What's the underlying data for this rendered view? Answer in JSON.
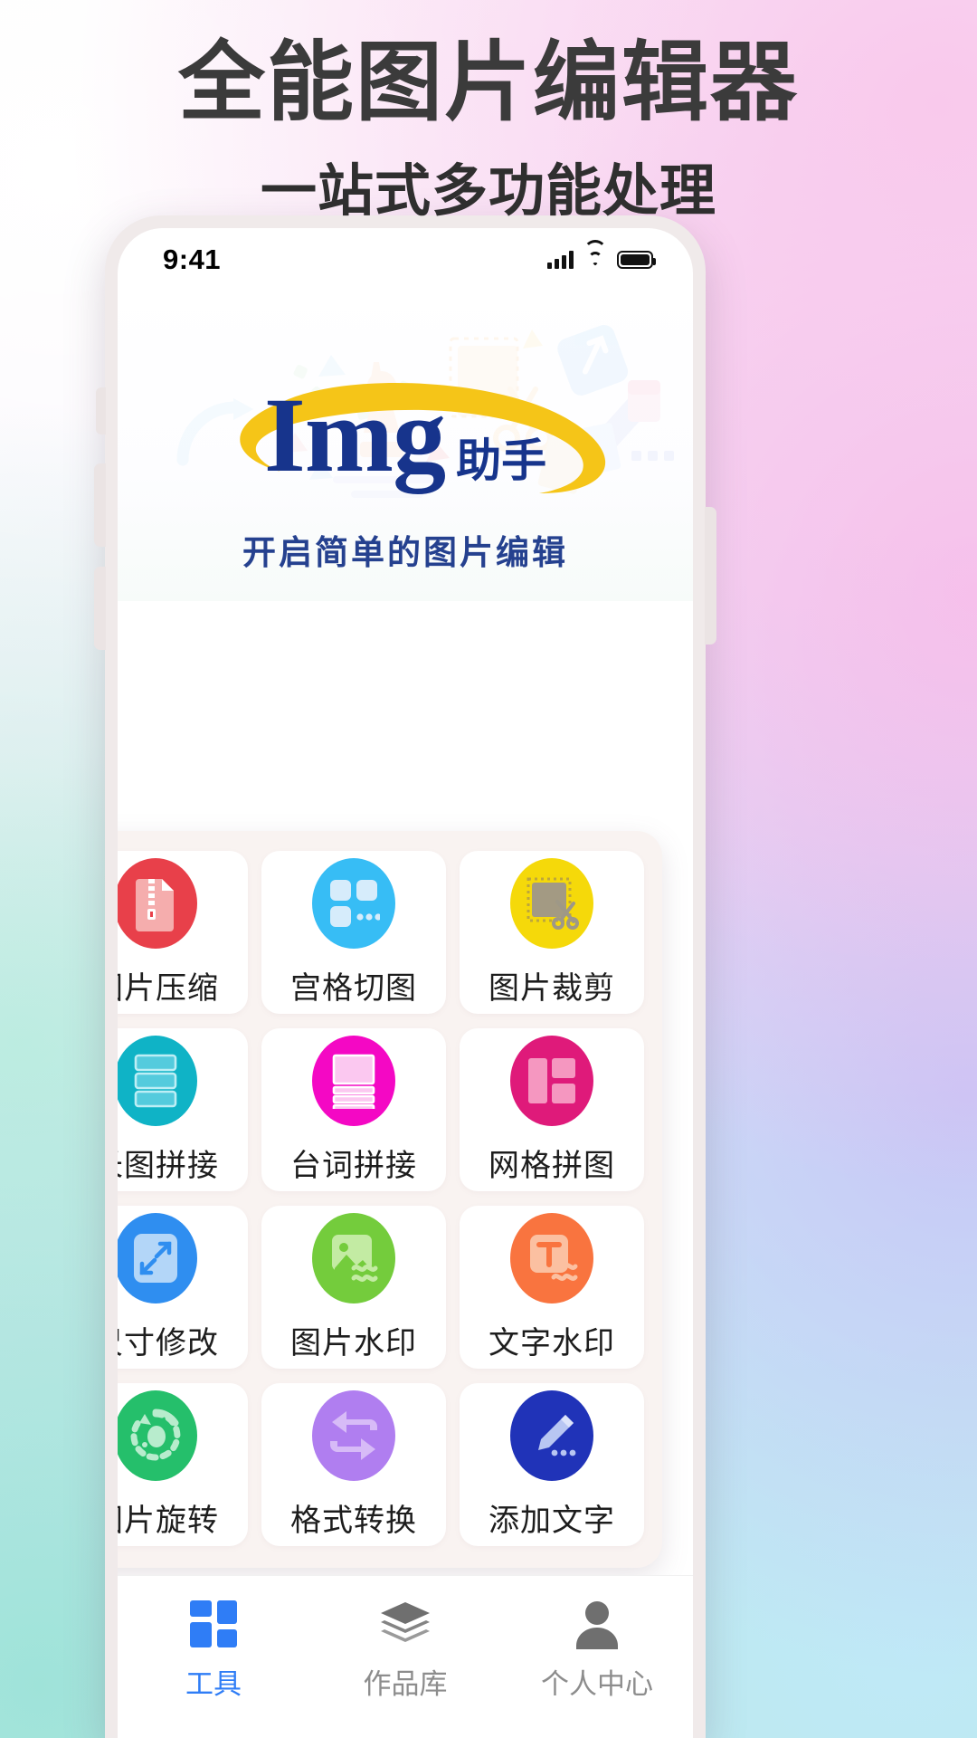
{
  "poster": {
    "title": "全能图片编辑器",
    "subtitle": "一站式多功能处理",
    "colors": {
      "accent": "#2f7df6",
      "brand_blue": "#17348c",
      "brand_yellow": "#f5c518"
    }
  },
  "phone": {
    "statusbar": {
      "clock": "9:41",
      "signal_icon": "signal-bars-icon",
      "wifi_icon": "wifi-icon",
      "battery_icon": "battery-full-icon"
    }
  },
  "hero": {
    "logo_main": "Img",
    "logo_cn": "助手",
    "tagline": "开启简单的图片编辑",
    "swoosh_icon": "orbit-swoosh-icon"
  },
  "tools": [
    {
      "label": "图片压缩",
      "icon": "compress-file-icon",
      "color": "#e8404a",
      "fg": "#f5adad"
    },
    {
      "label": "宫格切图",
      "icon": "grid-split-icon",
      "color": "#37bdf5",
      "fg": "#d6ecfb"
    },
    {
      "label": "图片裁剪",
      "icon": "crop-scissors-icon",
      "color": "#f5d90a",
      "fg": "#a39a83"
    },
    {
      "label": "长图拼接",
      "icon": "long-stitch-icon",
      "color": "#0fb3c6",
      "fg": "#54cbdd"
    },
    {
      "label": "台词拼接",
      "icon": "subtitle-stitch-icon",
      "color": "#f408c4",
      "fg": "#fbc8f0"
    },
    {
      "label": "网格拼图",
      "icon": "grid-collage-icon",
      "color": "#df1a7a",
      "fg": "#f597c0"
    },
    {
      "label": "尺寸修改",
      "icon": "resize-arrows-icon",
      "color": "#2f8ef0",
      "fg": "#b3d6f8"
    },
    {
      "label": "图片水印",
      "icon": "image-watermark-icon",
      "color": "#74cc3c",
      "fg": "#c3eba3"
    },
    {
      "label": "文字水印",
      "icon": "text-watermark-icon",
      "color": "#f9743f",
      "fg": "#fbc0a1"
    },
    {
      "label": "图片旋转",
      "icon": "rotate-image-icon",
      "color": "#25bf6b",
      "fg": "#b8eccd"
    },
    {
      "label": "格式转换",
      "icon": "format-convert-icon",
      "color": "#a museum",
      "fg": "#d7bbf7"
    },
    {
      "label": "添加文字",
      "icon": "add-text-pencil-icon",
      "color": "#2033b8",
      "fg": "#b8c6f2"
    }
  ],
  "tabbar": [
    {
      "label": "工具",
      "icon": "tools-grid-icon",
      "active": true
    },
    {
      "label": "作品库",
      "icon": "layers-icon",
      "active": false
    },
    {
      "label": "个人中心",
      "icon": "person-icon",
      "active": false
    }
  ]
}
